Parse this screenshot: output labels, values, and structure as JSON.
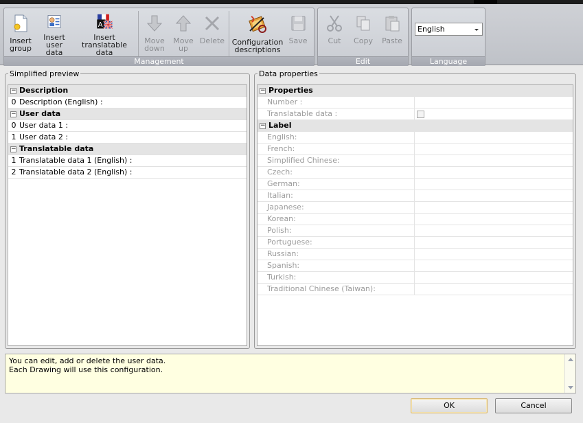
{
  "ribbon": {
    "management": {
      "caption": "Management",
      "insert_group": [
        "Insert",
        "group"
      ],
      "insert_user_data": [
        "Insert",
        "user data"
      ],
      "insert_translatable": [
        "Insert",
        "translatable data"
      ],
      "move_down": [
        "Move",
        "down"
      ],
      "move_up": [
        "Move",
        "up"
      ],
      "delete": "Delete",
      "configuration": [
        "Configuration",
        "descriptions"
      ],
      "save": "Save"
    },
    "edit": {
      "caption": "Edit",
      "cut": "Cut",
      "copy": "Copy",
      "paste": "Paste"
    },
    "language": {
      "caption": "Language",
      "selected": "English"
    }
  },
  "preview": {
    "legend": "Simplified preview",
    "rows": [
      {
        "type": "group",
        "toggle": "−",
        "label": "Description"
      },
      {
        "type": "item",
        "idx": "0",
        "label": "Description (English) :"
      },
      {
        "type": "group",
        "toggle": "−",
        "label": "User data"
      },
      {
        "type": "item",
        "idx": "0",
        "label": "User data 1 :"
      },
      {
        "type": "item",
        "idx": "1",
        "label": "User data 2 :"
      },
      {
        "type": "group",
        "toggle": "−",
        "label": "Translatable data"
      },
      {
        "type": "item",
        "idx": "1",
        "label": "Translatable data 1 (English) :"
      },
      {
        "type": "item",
        "idx": "2",
        "label": "Translatable data 2 (English) :"
      }
    ]
  },
  "properties": {
    "legend": "Data properties",
    "rows": [
      {
        "type": "group",
        "toggle": "−",
        "label": "Properties"
      },
      {
        "type": "item",
        "label": "Number :"
      },
      {
        "type": "check",
        "label": "Translatable data :"
      },
      {
        "type": "group",
        "toggle": "−",
        "label": "Label"
      },
      {
        "type": "item",
        "label": "English:"
      },
      {
        "type": "item",
        "label": "French:"
      },
      {
        "type": "item",
        "label": "Simplified Chinese:"
      },
      {
        "type": "item",
        "label": "Czech:"
      },
      {
        "type": "item",
        "label": "German:"
      },
      {
        "type": "item",
        "label": "Italian:"
      },
      {
        "type": "item",
        "label": "Japanese:"
      },
      {
        "type": "item",
        "label": "Korean:"
      },
      {
        "type": "item",
        "label": "Polish:"
      },
      {
        "type": "item",
        "label": "Portuguese:"
      },
      {
        "type": "item",
        "label": "Russian:"
      },
      {
        "type": "item",
        "label": "Spanish:"
      },
      {
        "type": "item",
        "label": "Turkish:"
      },
      {
        "type": "item",
        "label": "Traditional Chinese (Taiwan):"
      }
    ]
  },
  "info": {
    "line1": "You can edit, add or delete the user data.",
    "line2": "Each Drawing will use this configuration."
  },
  "buttons": {
    "ok": "OK",
    "cancel": "Cancel"
  },
  "colors": {
    "ribbon_bg": "#c8cbd1",
    "info_bg": "#ffffe1",
    "group_caption": "#a9acb4"
  }
}
